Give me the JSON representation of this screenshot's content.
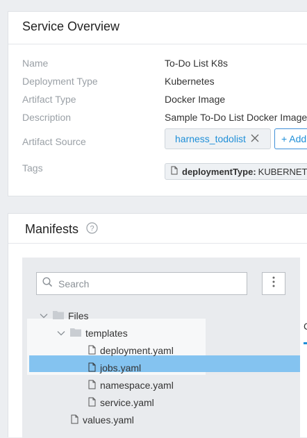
{
  "overview": {
    "title": "Service Overview",
    "fields": {
      "name": {
        "label": "Name",
        "value": "To-Do List K8s"
      },
      "deployment_type": {
        "label": "Deployment Type",
        "value": "Kubernetes"
      },
      "artifact_type": {
        "label": "Artifact Type",
        "value": "Docker Image"
      },
      "description": {
        "label": "Description",
        "value": "Sample To-Do List Docker Image"
      },
      "artifact_source": {
        "label": "Artifact Source",
        "chip": "harness_todolist",
        "add_label": "+ Add"
      },
      "tags": {
        "label": "Tags",
        "key": "deploymentType:",
        "value": "KUBERNETES"
      }
    }
  },
  "manifests": {
    "title": "Manifests",
    "help_icon": "question-circle-icon",
    "search_placeholder": "Search",
    "tree": {
      "root": "Files",
      "folder": "templates",
      "files": [
        "deployment.yaml",
        "jobs.yaml",
        "namespace.yaml",
        "service.yaml"
      ],
      "root_file": "values.yaml",
      "selected": "jobs.yaml"
    },
    "right_tab_partial": "C"
  },
  "colors": {
    "accent": "#1f8fd8",
    "selected_row": "#84c3f0",
    "background": "#eceef1"
  }
}
